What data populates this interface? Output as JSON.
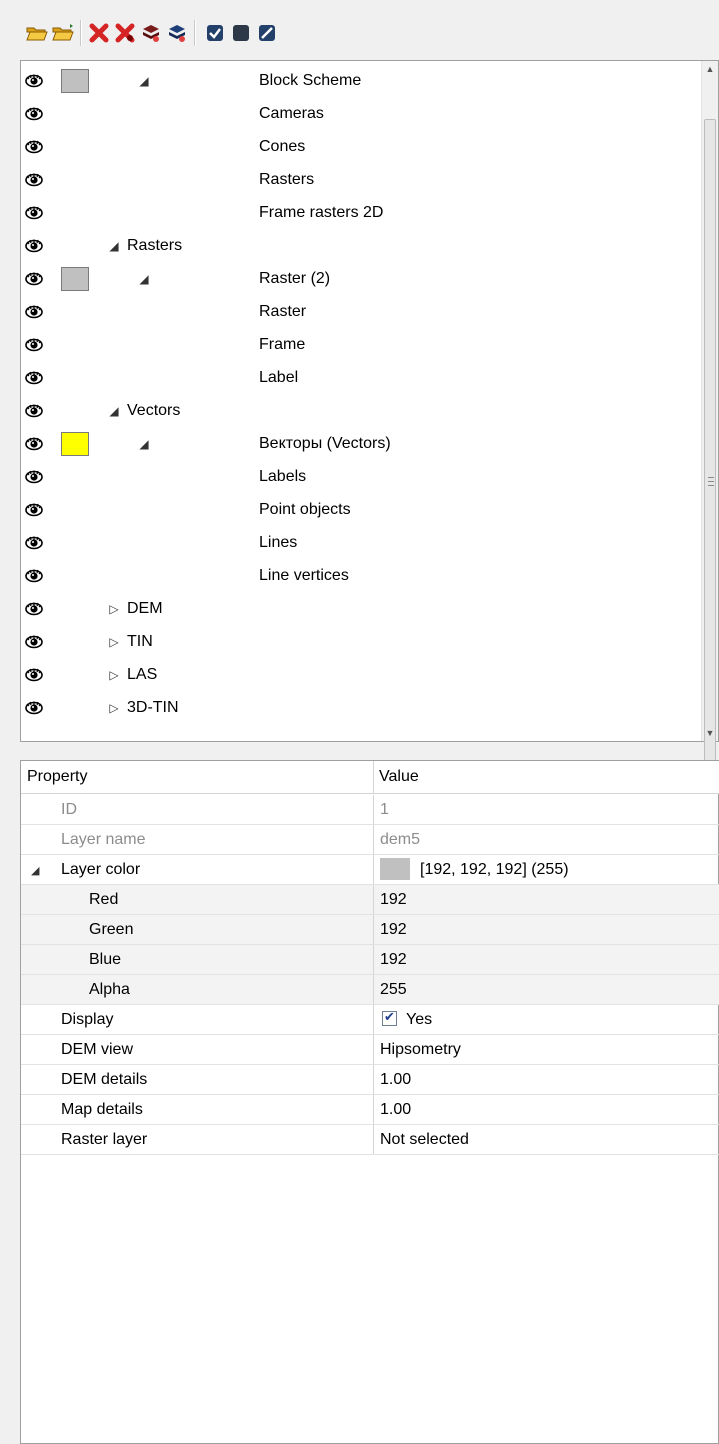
{
  "toolbar": {
    "buttons": [
      {
        "icon": "open-folder-icon"
      },
      {
        "icon": "open-folder-arrow-icon"
      },
      {
        "icon": "delete-icon"
      },
      {
        "icon": "delete-all-icon"
      },
      {
        "icon": "layers-remove-icon"
      },
      {
        "icon": "layers-remove-all-icon"
      },
      {
        "icon": "check-all-icon"
      },
      {
        "icon": "uncheck-all-icon"
      },
      {
        "icon": "invert-check-icon"
      }
    ]
  },
  "tree": {
    "rows": [
      {
        "label": "Block Scheme",
        "swatch": "#c0c0c0",
        "expander": "◢",
        "level": 2
      },
      {
        "label": "Cameras",
        "level": 3
      },
      {
        "label": "Cones",
        "level": 3
      },
      {
        "label": "Rasters",
        "level": 3
      },
      {
        "label": "Frame rasters 2D",
        "level": 3
      },
      {
        "label": "Rasters",
        "expander": "◢",
        "level": 1
      },
      {
        "label": "Raster (2)",
        "swatch": "#c0c0c0",
        "expander": "◢",
        "level": 2
      },
      {
        "label": "Raster",
        "level": 3
      },
      {
        "label": "Frame",
        "level": 3
      },
      {
        "label": "Label",
        "level": 3
      },
      {
        "label": "Vectors",
        "expander": "◢",
        "level": 1
      },
      {
        "label": "Векторы (Vectors)",
        "swatch": "#ffff00",
        "expander": "◢",
        "level": 2
      },
      {
        "label": "Labels",
        "level": 3
      },
      {
        "label": "Point objects",
        "level": 3
      },
      {
        "label": "Lines",
        "level": 3
      },
      {
        "label": "Line vertices",
        "level": 3
      },
      {
        "label": "DEM",
        "expander": "▷",
        "level": 1
      },
      {
        "label": "TIN",
        "expander": "▷",
        "level": 1
      },
      {
        "label": "LAS",
        "expander": "▷",
        "level": 1
      },
      {
        "label": "3D-TIN",
        "expander": "▷",
        "level": 1
      }
    ]
  },
  "properties": {
    "header": {
      "property": "Property",
      "value": "Value"
    },
    "rows": [
      {
        "name": "ID",
        "value": "1",
        "readonly": true
      },
      {
        "name": "Layer name",
        "value": "dem5",
        "readonly": true
      },
      {
        "name": "Layer color",
        "value": "[192, 192, 192] (255)",
        "expander": "◢",
        "color": "#c0c0c0"
      },
      {
        "name": "Red",
        "value": "192",
        "indent": true
      },
      {
        "name": "Green",
        "value": "192",
        "indent": true
      },
      {
        "name": "Blue",
        "value": "192",
        "indent": true
      },
      {
        "name": "Alpha",
        "value": "255",
        "indent": true
      },
      {
        "name": "Display",
        "value": "Yes",
        "checked": true
      },
      {
        "name": "DEM view",
        "value": "Hipsometry"
      },
      {
        "name": "DEM details",
        "value": "1.00"
      },
      {
        "name": "Map details",
        "value": "1.00"
      },
      {
        "name": "Raster layer",
        "value": "Not selected"
      }
    ]
  }
}
